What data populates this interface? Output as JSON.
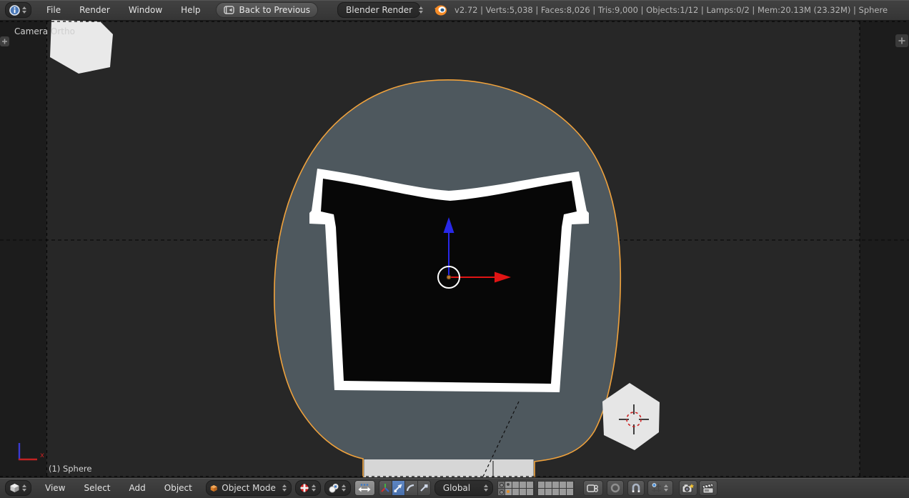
{
  "header": {
    "menus": [
      "File",
      "Render",
      "Window",
      "Help"
    ],
    "back_button_label": "Back to Previous",
    "engine_dropdown_value": "Blender Render",
    "stats_text": "v2.72 | Verts:5,038 | Faces:8,026 | Tris:9,000 | Objects:1/12 | Lamps:0/2 | Mem:20.13M (23.32M) | Sphere"
  },
  "viewport": {
    "view_name_label": "Camera Ortho",
    "active_object_label": "(1) Sphere",
    "axis_gizmo_x_label": "x"
  },
  "toolbar": {
    "menus": [
      "View",
      "Select",
      "Add",
      "Object"
    ],
    "mode_dropdown_value": "Object Mode",
    "orientation_dropdown_value": "Global"
  },
  "colors": {
    "selection_outline_orange": "#f0a23c",
    "object_slate_gray": "#4e585e",
    "visor_black": "#070707",
    "visor_border_white": "#ffffff",
    "translate_active_blue": "#5e86c4",
    "axis_x_red": "#e01414",
    "axis_z_blue": "#2828e8",
    "active_layer_dot_orange": "#e08f2c",
    "lamp_circle_red": "#cc2222"
  }
}
